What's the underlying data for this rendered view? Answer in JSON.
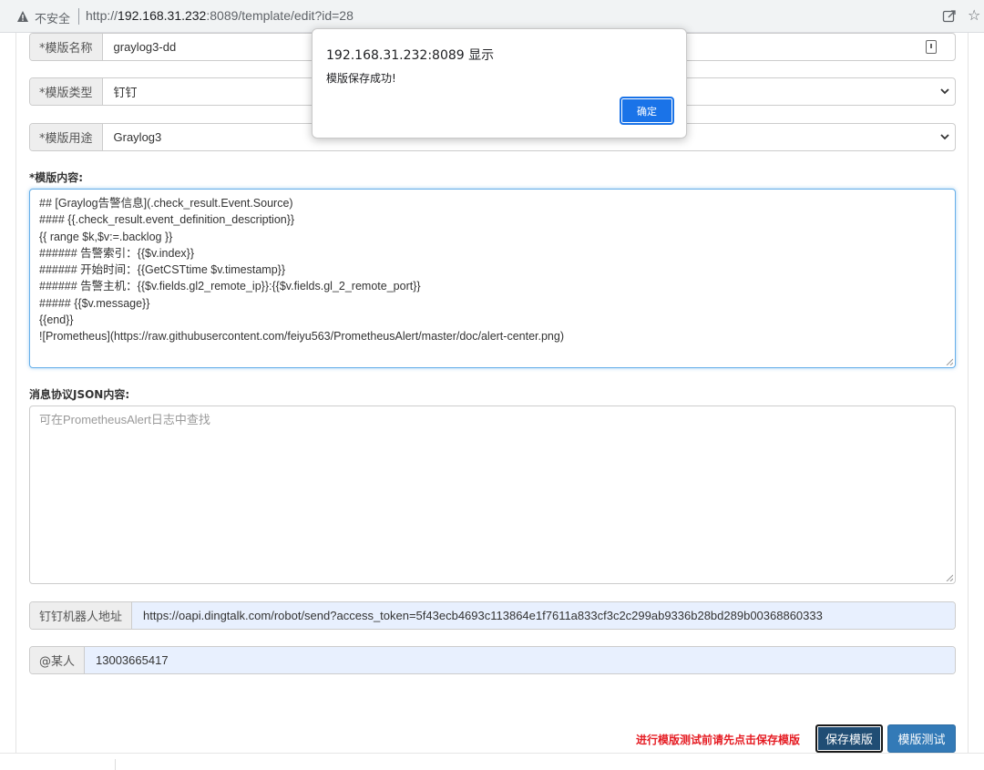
{
  "browser": {
    "security_label": "不安全",
    "url_prefix": "http://",
    "url_host": "192.168.31.232",
    "url_rest": ":8089/template/edit?id=28"
  },
  "form": {
    "name": {
      "label": "*模版名称",
      "value": "graylog3-dd"
    },
    "type": {
      "label": "*模版类型",
      "value": "钉钉"
    },
    "usage": {
      "label": "*模版用途",
      "value": "Graylog3"
    },
    "content_label": "*模版内容:",
    "content_lines": [
      "## [Graylog告警信息](.check_result.Event.Source)",
      "#### {{.check_result.event_definition_description}}",
      "{{ range $k,$v:=.backlog }}",
      "###### 告警索引：{{$v.index}}",
      "###### 开始时间：{{GetCSTtime $v.timestamp}}",
      "###### 告警主机：{{$v.fields.gl2_remote_ip}}:{{$v.fields.gl_2_remote_port}}",
      "##### {{$v.message}}",
      "{{end}}",
      "![Prometheus](https://raw.githubusercontent.com/feiyu563/PrometheusAlert/master/doc/alert-center.png)"
    ],
    "json_label": "消息协议JSON内容:",
    "json_placeholder": "可在PrometheusAlert日志中查找",
    "robot": {
      "label": "钉钉机器人地址",
      "value": "https://oapi.dingtalk.com/robot/send?access_token=5f43ecb4693c113864e1f7611a833cf3c2c299ab9336b28bd289b00368860333"
    },
    "at": {
      "label": "@某人",
      "value": "13003665417"
    }
  },
  "footer": {
    "hint": "进行模版测试前请先点击保存模版",
    "save_label": "保存模版",
    "test_label": "模版测试"
  },
  "dialog": {
    "title": "192.168.31.232:8089 显示",
    "message": "模版保存成功!",
    "ok_label": "确定"
  },
  "colors": {
    "primary": "#337ab7",
    "hint": "#e51c23",
    "dialog_button": "#1a73e8"
  }
}
